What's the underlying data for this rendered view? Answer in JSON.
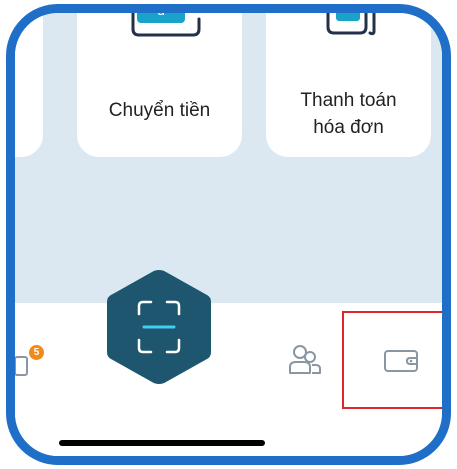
{
  "quick_actions": {
    "transfer_label": "Chuyển tiền",
    "bill_label_line1": "Thanh toán",
    "bill_label_line2": "hóa đơn"
  },
  "tabbar": {
    "notifications_badge": "5"
  },
  "colors": {
    "frame": "#1f6fc8",
    "accent_teal": "#1aa3c8",
    "scan_hex": "#1e5670",
    "badge": "#f08a1c",
    "highlight": "#e0262a",
    "background_tint": "#dbe8f1"
  },
  "icons": {
    "transfer": "transfer-icon",
    "bill": "bill-icon",
    "scan": "qr-scan-icon",
    "notifications": "notification-icon",
    "contacts": "contacts-icon",
    "wallet": "wallet-icon"
  }
}
